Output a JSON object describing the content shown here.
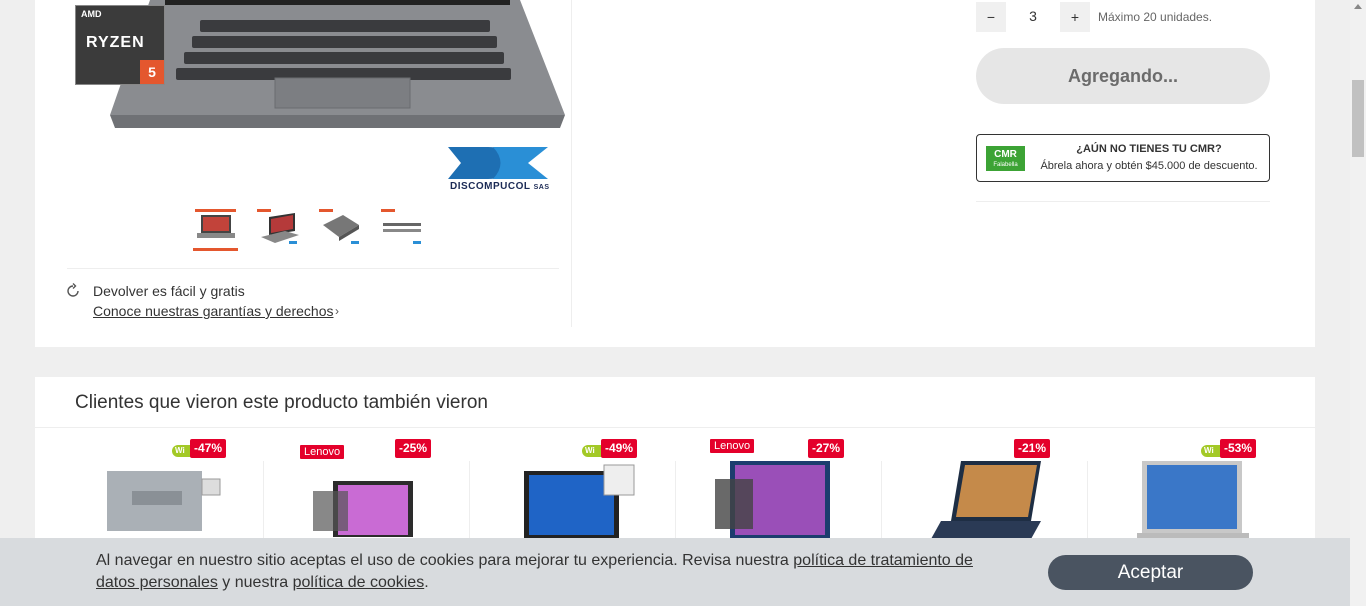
{
  "gallery": {
    "badge": {
      "brand": "AMD",
      "word": "RYZEN",
      "number": "5"
    },
    "seller_logo": {
      "name": "DISCOMPUCOL",
      "suffix": "SAS"
    },
    "thumbnails": [
      "thumbnail-front",
      "thumbnail-angle",
      "thumbnail-open",
      "thumbnail-closed"
    ],
    "returns": {
      "title": "Devolver es fácil y gratis",
      "link": "Conoce nuestras garantías y derechos"
    }
  },
  "purchase": {
    "quantity_value": "3",
    "quantity_minus": "−",
    "quantity_plus": "+",
    "max_note": "Máximo 20 unidades.",
    "add_button": "Agregando..."
  },
  "cmr": {
    "logo_main": "CMR",
    "logo_sub": "Falabella",
    "title": "¿AÚN NO TIENES TU CMR?",
    "subtitle": "Ábrela ahora y obtén $45.000 de descuento."
  },
  "recommendations": {
    "title": "Clientes que vieron este producto también vieron",
    "products": [
      {
        "discount": "-47%",
        "tag": "Wi",
        "brand": ""
      },
      {
        "discount": "-25%",
        "tag": "",
        "brand": "Lenovo"
      },
      {
        "discount": "-49%",
        "tag": "Wi",
        "brand": ""
      },
      {
        "discount": "-27%",
        "tag": "",
        "brand": "Lenovo"
      },
      {
        "discount": "-21%",
        "tag": "",
        "brand": ""
      },
      {
        "discount": "-53%",
        "tag": "Wi",
        "brand": ""
      }
    ]
  },
  "cookies": {
    "text_part1": "Al navegar en nuestro sitio aceptas el uso de cookies para mejorar tu experiencia. Revisa nuestra ",
    "link_privacy": "política de tratamiento de datos personales",
    "text_part2": " y nuestra ",
    "link_cookies": "política de cookies",
    "text_part3": ".",
    "accept": "Aceptar"
  },
  "colors": {
    "accent_red": "#e4002b",
    "cmr_green": "#3ca335",
    "button_dark": "#4a5461"
  }
}
